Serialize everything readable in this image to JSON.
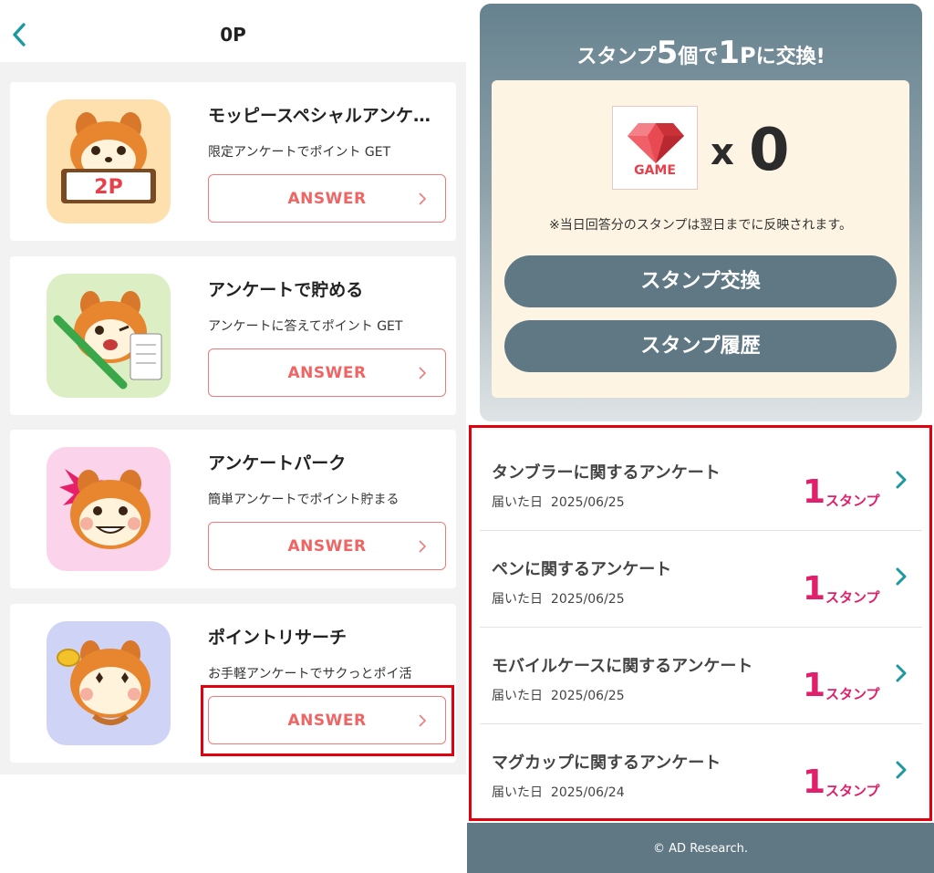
{
  "header": {
    "points": "0P"
  },
  "colors": {
    "accent_teal": "#1a9aa0",
    "answer_red": "#f06464",
    "stamp_pink": "#e0206a",
    "panel_slate": "#5f7884",
    "highlight": "#e3000e"
  },
  "surveys": [
    {
      "title": "モッピースペシャルアンケート",
      "desc": "限定アンケートでポイント GET",
      "button": "ANSWER",
      "badge": "2P"
    },
    {
      "title": "アンケートで貯める",
      "desc": "アンケートに答えてポイント GET",
      "button": "ANSWER"
    },
    {
      "title": "アンケートパーク",
      "desc": "簡単アンケートでポイント貯まる",
      "button": "ANSWER"
    },
    {
      "title": "ポイントリサーチ",
      "desc": "お手軽アンケートでサクっとポイ活",
      "button": "ANSWER"
    }
  ],
  "stamp": {
    "heading_pre": "スタンプ",
    "heading_num1": "5",
    "heading_mid": "個で",
    "heading_num2": "1",
    "heading_unit": "P",
    "heading_post": "に交換!",
    "game_label": "GAME",
    "multiplier": "x",
    "count": "0",
    "note": "※当日回答分のスタンプは翌日までに反映されます。",
    "exchange_button": "スタンプ交換",
    "history_button": "スタンプ履歴"
  },
  "stamp_surveys": [
    {
      "title": "タンブラーに関するアンケート",
      "date_label": "届いた日",
      "date": "2025/06/25",
      "stamps": "1",
      "unit": "スタンプ"
    },
    {
      "title": "ペンに関するアンケート",
      "date_label": "届いた日",
      "date": "2025/06/25",
      "stamps": "1",
      "unit": "スタンプ"
    },
    {
      "title": "モバイルケースに関するアンケート",
      "date_label": "届いた日",
      "date": "2025/06/25",
      "stamps": "1",
      "unit": "スタンプ"
    },
    {
      "title": "マグカップに関するアンケート",
      "date_label": "届いた日",
      "date": "2025/06/24",
      "stamps": "1",
      "unit": "スタンプ"
    }
  ],
  "footer": {
    "copyright": "© AD Research."
  }
}
